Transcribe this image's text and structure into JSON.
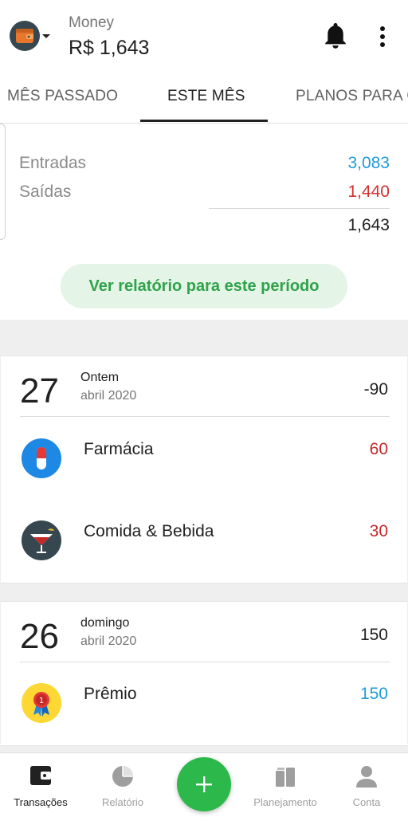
{
  "header": {
    "account_name": "Money",
    "balance": "R$ 1,643",
    "wallet_icon": "wallet-icon",
    "bell_icon": "bell-icon",
    "more_icon": "more-vert-icon"
  },
  "tabs": [
    {
      "label": "MÊS PASSADO",
      "active": false
    },
    {
      "label": "ESTE MÊS",
      "active": true
    },
    {
      "label": "PLANOS PARA O FUTURO",
      "active": false
    }
  ],
  "summary": {
    "income_label": "Entradas",
    "income_value": "3,083",
    "expense_label": "Saídas",
    "expense_value": "1,440",
    "net_value": "1,643",
    "report_button": "Ver relatório para este período"
  },
  "days": [
    {
      "day": "27",
      "weekday": "Ontem",
      "month_year": "abril 2020",
      "total": "-90",
      "transactions": [
        {
          "category": "Farmácia",
          "amount": "60",
          "icon": "pharmacy-icon"
        },
        {
          "category": "Comida & Bebida",
          "amount": "30",
          "icon": "food-drink-icon"
        }
      ]
    },
    {
      "day": "26",
      "weekday": "domingo",
      "month_year": "abril 2020",
      "total": "150",
      "transactions": [
        {
          "category": "Prêmio",
          "amount": "150",
          "icon": "award-icon"
        }
      ]
    }
  ],
  "bottom_nav": [
    {
      "label": "Transações",
      "icon": "wallet-icon",
      "active": true
    },
    {
      "label": "Relatório",
      "icon": "pie-chart-icon",
      "active": false
    },
    {
      "label": "Planejamento",
      "icon": "planning-icon",
      "active": false
    },
    {
      "label": "Conta",
      "icon": "account-icon",
      "active": false
    }
  ],
  "fab_icon": "plus-icon",
  "colors": {
    "accent_green": "#2db84b",
    "income_blue": "#1e9bd7",
    "expense_red": "#d32f2f"
  }
}
